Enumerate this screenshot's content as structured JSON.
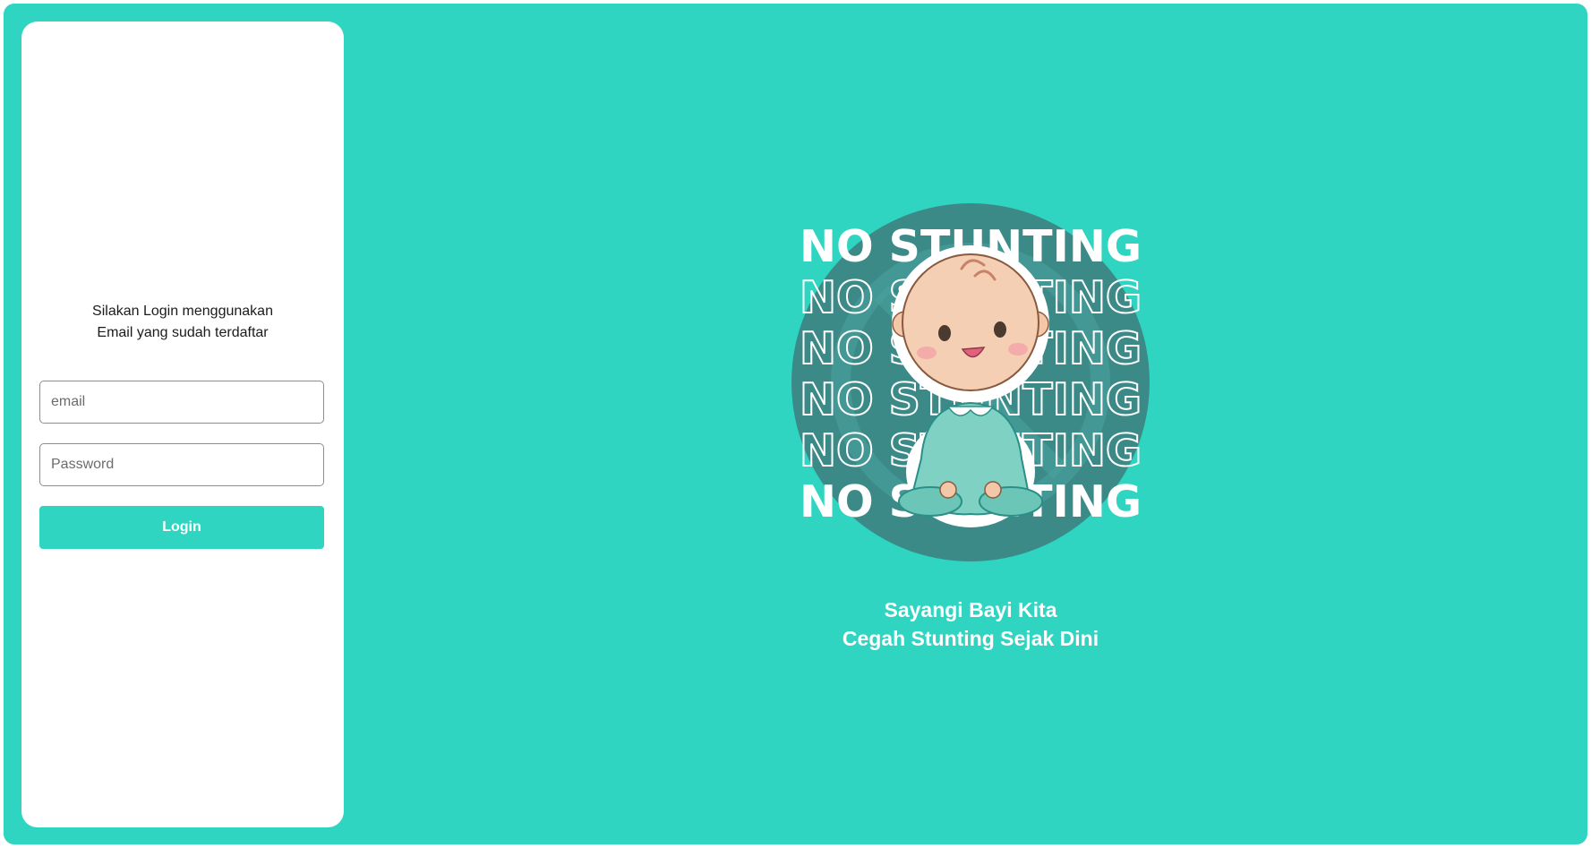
{
  "login": {
    "intro_line1": "Silakan Login menggunakan",
    "intro_line2": "Email yang sudah terdaftar",
    "email_placeholder": "email",
    "password_placeholder": "Password",
    "button_label": "Login"
  },
  "hero": {
    "headline": "NO STUNTING",
    "illustration": "baby-sitting-illustration",
    "tagline_line1": "Sayangi Bayi Kita",
    "tagline_line2": "Cegah Stunting Sejak Dini"
  },
  "colors": {
    "background": "#2fd5c1",
    "card": "#ffffff",
    "button": "#2fd5c1",
    "badge_circle": "#3c8a88"
  }
}
